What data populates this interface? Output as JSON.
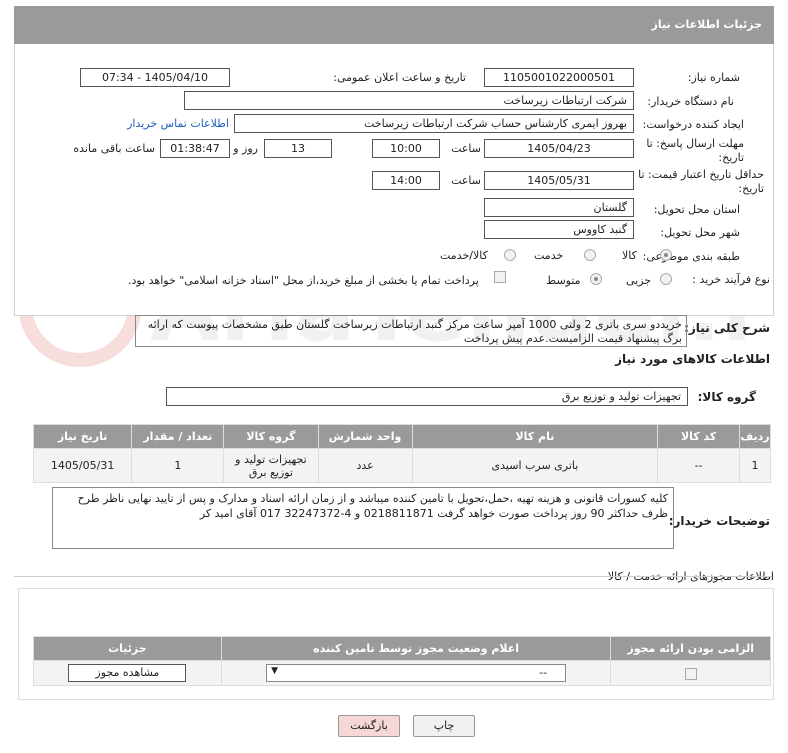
{
  "header": {
    "title": "جزئیات اطلاعات نیاز"
  },
  "fields": {
    "need_number_label": "شماره نیاز:",
    "need_number": "1105001022000501",
    "announce_label": "تاریخ و ساعت اعلان عمومی:",
    "announce_value": "1405/04/10 - 07:34",
    "buyer_org_label": "نام دستگاه خریدار:",
    "buyer_org": "شرکت ارتباطات زیرساخت",
    "creator_label": "ایجاد کننده درخواست:",
    "creator": "بهروز ایمری کارشناس حساب شرکت ارتباطات زیرساخت",
    "contact_link": "اطلاعات تماس خریدار",
    "deadline_label": "مهلت ارسال پاسخ: تا تاریخ:",
    "deadline_date": "1405/04/23",
    "time_label": "ساعت",
    "deadline_time": "10:00",
    "days_value": "13",
    "days_label": "روز و",
    "remaining_time": "01:38:47",
    "remaining_label": "ساعت باقی مانده",
    "validity_label": "حداقل تاریخ اعتبار قیمت: تا تاریخ:",
    "validity_date": "1405/05/31",
    "validity_time": "14:00",
    "province_label": "استان محل تحویل:",
    "province": "گلستان",
    "city_label": "شهر محل تحویل:",
    "city": "گنبد کاووس",
    "category_label": "طبقه بندی موضوعی:",
    "category_options": [
      "کالا",
      "خدمت",
      "کالا/خدمت"
    ],
    "process_label": "نوع فرآیند خرید :",
    "process_options": [
      "جزیی",
      "متوسط"
    ],
    "payment_note": "پرداخت تمام یا بخشی از مبلغ خرید،از محل \"اسناد خزانه اسلامی\" خواهد بود."
  },
  "description": {
    "label": "شرح کلی نیاز:",
    "text": "خریددو سری باتری 2 ولتی 1000 آمپر ساعت مرکز گنبد ارتباطات زیرساخت گلستان طبق مشخصات پیوست که ارائه برگ پیشنهاد قیمت الزامیست.عدم پیش پرداخت"
  },
  "goods_section": {
    "title": "اطلاعات کالاهای مورد نیاز",
    "group_label": "گروه کالا:",
    "group_value": "تجهیزات تولید و توزیع برق",
    "columns": [
      "ردیف",
      "کد کالا",
      "نام کالا",
      "واحد شمارش",
      "گروه کالا",
      "تعداد / مقدار",
      "تاریخ نیاز"
    ],
    "rows": [
      [
        "1",
        "--",
        "باتری سرب اسیدی",
        "عدد",
        "تجهیزات تولید و توزیع برق",
        "1",
        "1405/05/31"
      ]
    ]
  },
  "buyer_notes": {
    "label": "توضیحات خریدار:",
    "text": "کلیه کسورات قانونی و هزینه تهیه ،حمل،تحویل با تامین کننده میباشد و از زمان ارائه اسناد و مدارک و پس از تایید نهایی ناظر طرح ظرف حداکثر 90 روز پرداخت صورت خواهد گرفت 0218811871 و 4-32247372 017 آقای امید کر"
  },
  "permits": {
    "title": "اطلاعات مجوزهای ارائه خدمت / کالا",
    "columns": [
      "الزامی بودن ارائه مجوز",
      "اعلام وضعیت مجوز توسط تامین کننده",
      "جزئیات"
    ],
    "select_value": "--",
    "view_button": "مشاهده مجوز"
  },
  "buttons": {
    "print": "چاپ",
    "back": "بازگشت"
  },
  "colors": {
    "header_bg": "#9a9a9a",
    "link": "#1f5fbf",
    "back_button_bg": "#f6d6d6"
  }
}
